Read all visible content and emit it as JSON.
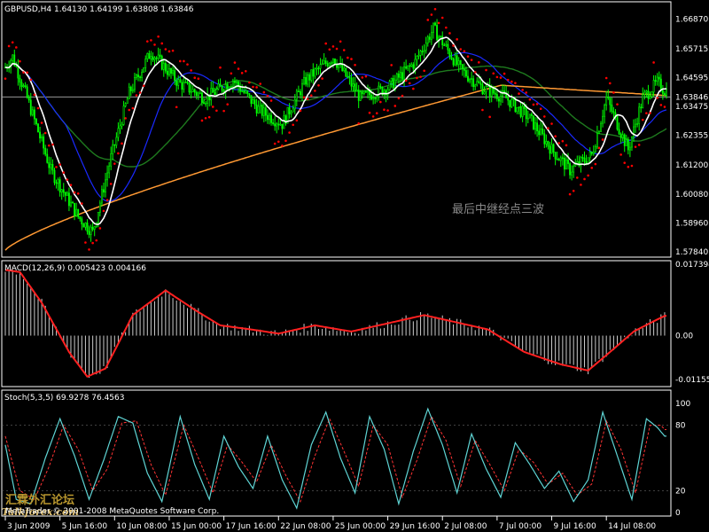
{
  "chart_data": [
    {
      "type": "candlestick",
      "panel": "price",
      "title": "GBPUSD,H4  1.64130 1.64199 1.63808 1.63846",
      "ylim": [
        1.577,
        1.674
      ],
      "y_ticks": [
        "1.66870",
        "1.65715",
        "1.64595",
        "1.63846",
        "1.63475",
        "1.62355",
        "1.61200",
        "1.60080",
        "1.58960",
        "1.57840"
      ],
      "current_price": "1.63846",
      "colors": {
        "bull": "#00ff00",
        "bear": "#00ff00",
        "sar": "#ff0000",
        "ma_fast": "#ffffff",
        "ma_blue": "#1a2aff",
        "ma_green": "#1e7a1e",
        "ma_orange": "#ff9933",
        "price_line": "#aaaaaa"
      },
      "annotation": "最后中继经点三波",
      "anchors": [
        [
          0,
          1.65
        ],
        [
          4,
          1.654
        ],
        [
          12,
          1.638
        ],
        [
          25,
          1.61
        ],
        [
          40,
          1.592
        ],
        [
          48,
          1.586
        ],
        [
          58,
          1.615
        ],
        [
          68,
          1.64
        ],
        [
          80,
          1.656
        ],
        [
          95,
          1.644
        ],
        [
          110,
          1.638
        ],
        [
          125,
          1.645
        ],
        [
          140,
          1.633
        ],
        [
          152,
          1.628
        ],
        [
          165,
          1.645
        ],
        [
          180,
          1.654
        ],
        [
          195,
          1.638
        ],
        [
          210,
          1.642
        ],
        [
          225,
          1.652
        ],
        [
          235,
          1.665
        ],
        [
          250,
          1.649
        ],
        [
          262,
          1.642
        ],
        [
          275,
          1.638
        ],
        [
          288,
          1.63
        ],
        [
          300,
          1.618
        ],
        [
          310,
          1.61
        ],
        [
          322,
          1.616
        ],
        [
          330,
          1.638
        ],
        [
          342,
          1.618
        ],
        [
          350,
          1.638
        ],
        [
          358,
          1.644
        ],
        [
          362,
          1.641
        ]
      ]
    },
    {
      "type": "histogram+line",
      "panel": "macd",
      "title": "MACD(12,26,9) 0.005423 0.004166",
      "ylim": [
        -0.01155,
        0.01739
      ],
      "y_ticks": [
        "0.017394",
        "0.00",
        "-0.01155"
      ],
      "signal": [
        [
          0,
          0.016
        ],
        [
          8,
          0.0155
        ],
        [
          20,
          0.008
        ],
        [
          35,
          -0.004
        ],
        [
          45,
          -0.01
        ],
        [
          55,
          -0.008
        ],
        [
          70,
          0.005
        ],
        [
          88,
          0.011
        ],
        [
          105,
          0.006
        ],
        [
          118,
          0.0025
        ],
        [
          135,
          0.0015
        ],
        [
          150,
          0.0005
        ],
        [
          170,
          0.0025
        ],
        [
          190,
          0.001
        ],
        [
          210,
          0.003
        ],
        [
          230,
          0.005
        ],
        [
          245,
          0.0035
        ],
        [
          265,
          0.0015
        ],
        [
          285,
          -0.004
        ],
        [
          305,
          -0.007
        ],
        [
          320,
          -0.0085
        ],
        [
          332,
          -0.004
        ],
        [
          345,
          0.001
        ],
        [
          356,
          0.0035
        ],
        [
          362,
          0.0048
        ]
      ]
    },
    {
      "type": "line",
      "panel": "stoch",
      "title": "Stoch(5,3,5) 69.9278 76.4563",
      "ylim": [
        0,
        100
      ],
      "y_ticks": [
        "100",
        "80",
        "20",
        "0"
      ],
      "colors": {
        "main": "#5fd5d5",
        "signal": "#ff3333"
      },
      "main": [
        [
          0,
          62
        ],
        [
          6,
          12
        ],
        [
          14,
          8
        ],
        [
          22,
          50
        ],
        [
          30,
          86
        ],
        [
          38,
          52
        ],
        [
          46,
          12
        ],
        [
          54,
          48
        ],
        [
          62,
          88
        ],
        [
          70,
          82
        ],
        [
          78,
          36
        ],
        [
          86,
          10
        ],
        [
          96,
          88
        ],
        [
          104,
          44
        ],
        [
          112,
          12
        ],
        [
          120,
          70
        ],
        [
          128,
          42
        ],
        [
          136,
          22
        ],
        [
          144,
          70
        ],
        [
          152,
          30
        ],
        [
          160,
          4
        ],
        [
          168,
          62
        ],
        [
          176,
          92
        ],
        [
          184,
          50
        ],
        [
          192,
          18
        ],
        [
          200,
          88
        ],
        [
          208,
          58
        ],
        [
          216,
          8
        ],
        [
          224,
          56
        ],
        [
          232,
          95
        ],
        [
          240,
          62
        ],
        [
          248,
          18
        ],
        [
          256,
          72
        ],
        [
          264,
          40
        ],
        [
          272,
          14
        ],
        [
          280,
          64
        ],
        [
          288,
          44
        ],
        [
          296,
          22
        ],
        [
          304,
          38
        ],
        [
          312,
          10
        ],
        [
          320,
          30
        ],
        [
          328,
          92
        ],
        [
          336,
          52
        ],
        [
          344,
          12
        ],
        [
          352,
          86
        ],
        [
          358,
          78
        ],
        [
          362,
          70
        ]
      ],
      "signal": [
        [
          0,
          70
        ],
        [
          8,
          20
        ],
        [
          16,
          12
        ],
        [
          24,
          42
        ],
        [
          32,
          80
        ],
        [
          40,
          58
        ],
        [
          48,
          20
        ],
        [
          56,
          40
        ],
        [
          64,
          82
        ],
        [
          72,
          84
        ],
        [
          80,
          44
        ],
        [
          88,
          16
        ],
        [
          98,
          80
        ],
        [
          106,
          50
        ],
        [
          114,
          18
        ],
        [
          122,
          62
        ],
        [
          130,
          46
        ],
        [
          138,
          28
        ],
        [
          146,
          62
        ],
        [
          154,
          34
        ],
        [
          162,
          10
        ],
        [
          170,
          52
        ],
        [
          178,
          86
        ],
        [
          186,
          56
        ],
        [
          194,
          24
        ],
        [
          202,
          80
        ],
        [
          210,
          62
        ],
        [
          218,
          14
        ],
        [
          226,
          48
        ],
        [
          234,
          88
        ],
        [
          242,
          66
        ],
        [
          250,
          24
        ],
        [
          258,
          66
        ],
        [
          266,
          44
        ],
        [
          274,
          20
        ],
        [
          282,
          58
        ],
        [
          290,
          46
        ],
        [
          298,
          26
        ],
        [
          306,
          36
        ],
        [
          314,
          16
        ],
        [
          322,
          26
        ],
        [
          330,
          84
        ],
        [
          338,
          58
        ],
        [
          346,
          18
        ],
        [
          354,
          80
        ],
        [
          360,
          80
        ],
        [
          362,
          76
        ]
      ]
    }
  ],
  "x_labels": [
    {
      "i": 0,
      "text": "3 Jun 2009"
    },
    {
      "i": 30,
      "text": "5 Jun 16:00"
    },
    {
      "i": 60,
      "text": "10 Jun 08:00"
    },
    {
      "i": 90,
      "text": "15 Jun 00:00"
    },
    {
      "i": 120,
      "text": "17 Jun 16:00"
    },
    {
      "i": 150,
      "text": "22 Jun 08:00"
    },
    {
      "i": 180,
      "text": "25 Jun 00:00"
    },
    {
      "i": 210,
      "text": "29 Jun 16:00"
    },
    {
      "i": 240,
      "text": "2 Jul 08:00"
    },
    {
      "i": 270,
      "text": "7 Jul 00:00"
    },
    {
      "i": 300,
      "text": "9 Jul 16:00"
    },
    {
      "i": 330,
      "text": "14 Jul 08:00"
    }
  ],
  "copyright": "MetaTrader © 2001-2008 MetaQuotes Software Corp.",
  "brand_cn": "汇霖外汇论坛",
  "brand_en": "Talkforex.com"
}
